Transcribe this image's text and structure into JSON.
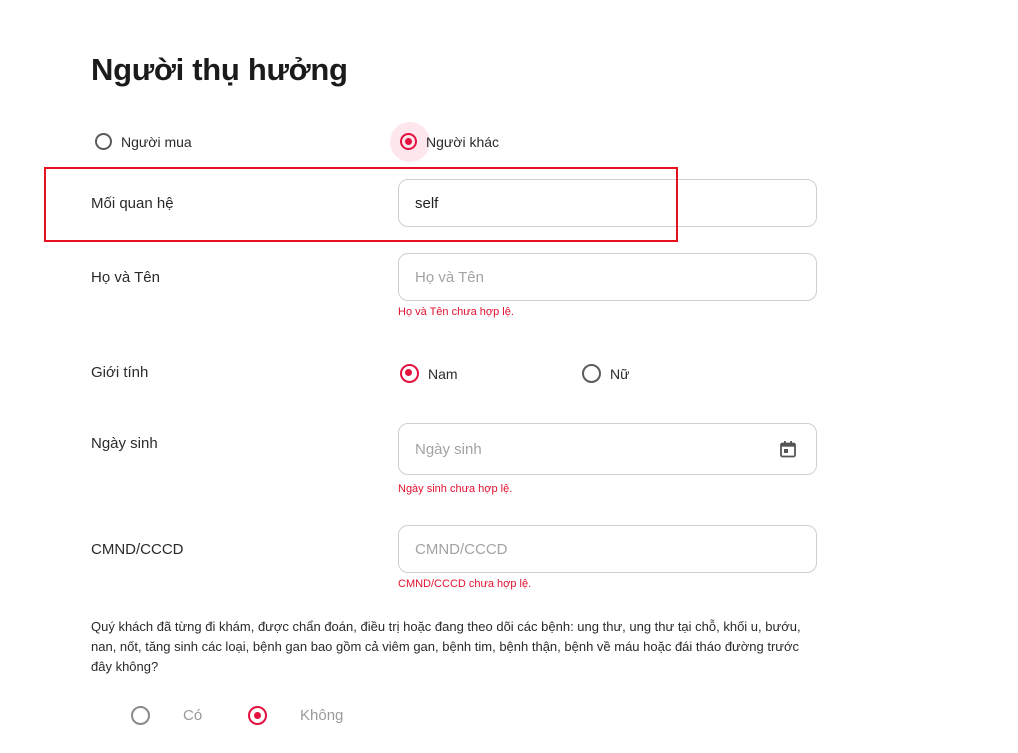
{
  "title": "Người thụ hưởng",
  "beneficiary": {
    "option_buyer": "Người mua",
    "option_other": "Người khác",
    "selected": "other"
  },
  "relationship": {
    "label": "Mối quan hệ",
    "value": "self"
  },
  "full_name": {
    "label": "Họ và Tên",
    "placeholder": "Họ và Tên",
    "error": "Họ và Tên chưa hợp lệ."
  },
  "gender": {
    "label": "Giới tính",
    "option_male": "Nam",
    "option_female": "Nữ",
    "selected": "male"
  },
  "birthdate": {
    "label": "Ngày sinh",
    "placeholder": "Ngày sinh",
    "error": "Ngày sinh chưa hợp lệ.",
    "icon": "calendar-icon"
  },
  "id_number": {
    "label": "CMND/CCCD",
    "placeholder": "CMND/CCCD",
    "error": "CMND/CCCD chưa hợp lệ."
  },
  "health_question": {
    "text": "Quý khách đã từng đi khám, được chẩn đoán, điều trị hoặc đang theo dõi các bệnh: ung thư, ung thư tại chỗ, khối u, bướu, nan, nốt, tăng sinh các loại, bệnh gan bao gồm cả viêm gan, bệnh tim, bệnh thận, bệnh về máu hoặc đái tháo đường trước đây không?",
    "option_yes": "Có",
    "option_no": "Không",
    "selected": "no"
  },
  "colors": {
    "accent": "#e4103f",
    "error": "#e0102f",
    "highlight_box": "#e8101f"
  }
}
